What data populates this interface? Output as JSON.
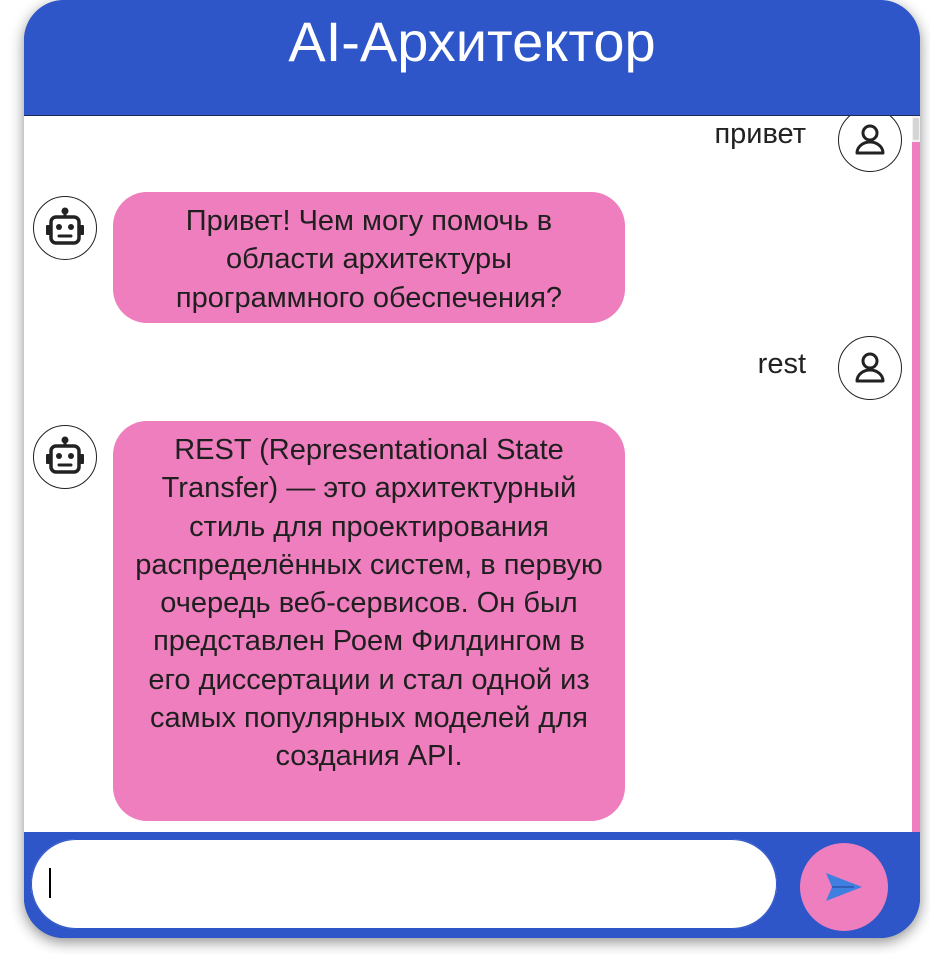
{
  "header": {
    "title": "AI-Архитектор"
  },
  "messages": [
    {
      "role": "user",
      "text": "привет",
      "avatar_icon": "user-icon"
    },
    {
      "role": "bot",
      "text": "Привет! Чем могу помочь в области архитектуры программного обеспечения?",
      "avatar_icon": "robot-icon"
    },
    {
      "role": "user",
      "text": "rest",
      "avatar_icon": "user-icon"
    },
    {
      "role": "bot",
      "text": "REST (Representational State Transfer) — это архитектурный стиль для проектирования распределённых систем, в первую очередь веб-сервисов. Он был представлен Роем Филдингом в его диссертации и стал одной из самых популярных моделей для создания API.",
      "avatar_icon": "robot-icon"
    }
  ],
  "composer": {
    "value": "",
    "placeholder": "",
    "send_icon": "send-arrow-icon"
  },
  "colors": {
    "header": "#2f56c9",
    "bubble": "#ee7ebd",
    "background": "#ffffff"
  }
}
